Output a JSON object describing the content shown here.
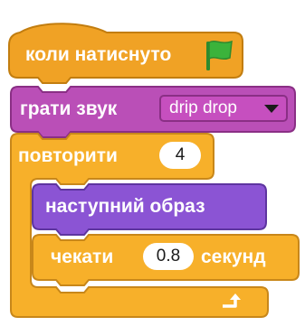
{
  "script": {
    "hat": {
      "label": "коли натиснуто",
      "icon": "green-flag-icon"
    },
    "play_sound": {
      "label": "грати звук",
      "sound": "drip drop"
    },
    "repeat": {
      "label": "повторити",
      "times": "4",
      "loop_icon": "loop-arrow-icon"
    },
    "next_costume": {
      "label": "наступний образ"
    },
    "wait": {
      "label": "чекати",
      "seconds": "0.8",
      "unit": "секунд"
    }
  },
  "colors": {
    "events": "#f0a225",
    "events_dark": "#c27d0f",
    "sound": "#ba4fb7",
    "sound_dark": "#8a2f85",
    "looks": "#8b54d4",
    "looks_dark": "#5e35a0",
    "control": "#f7b02a",
    "control_dark": "#c8871a",
    "flag": "#3bb33b"
  }
}
